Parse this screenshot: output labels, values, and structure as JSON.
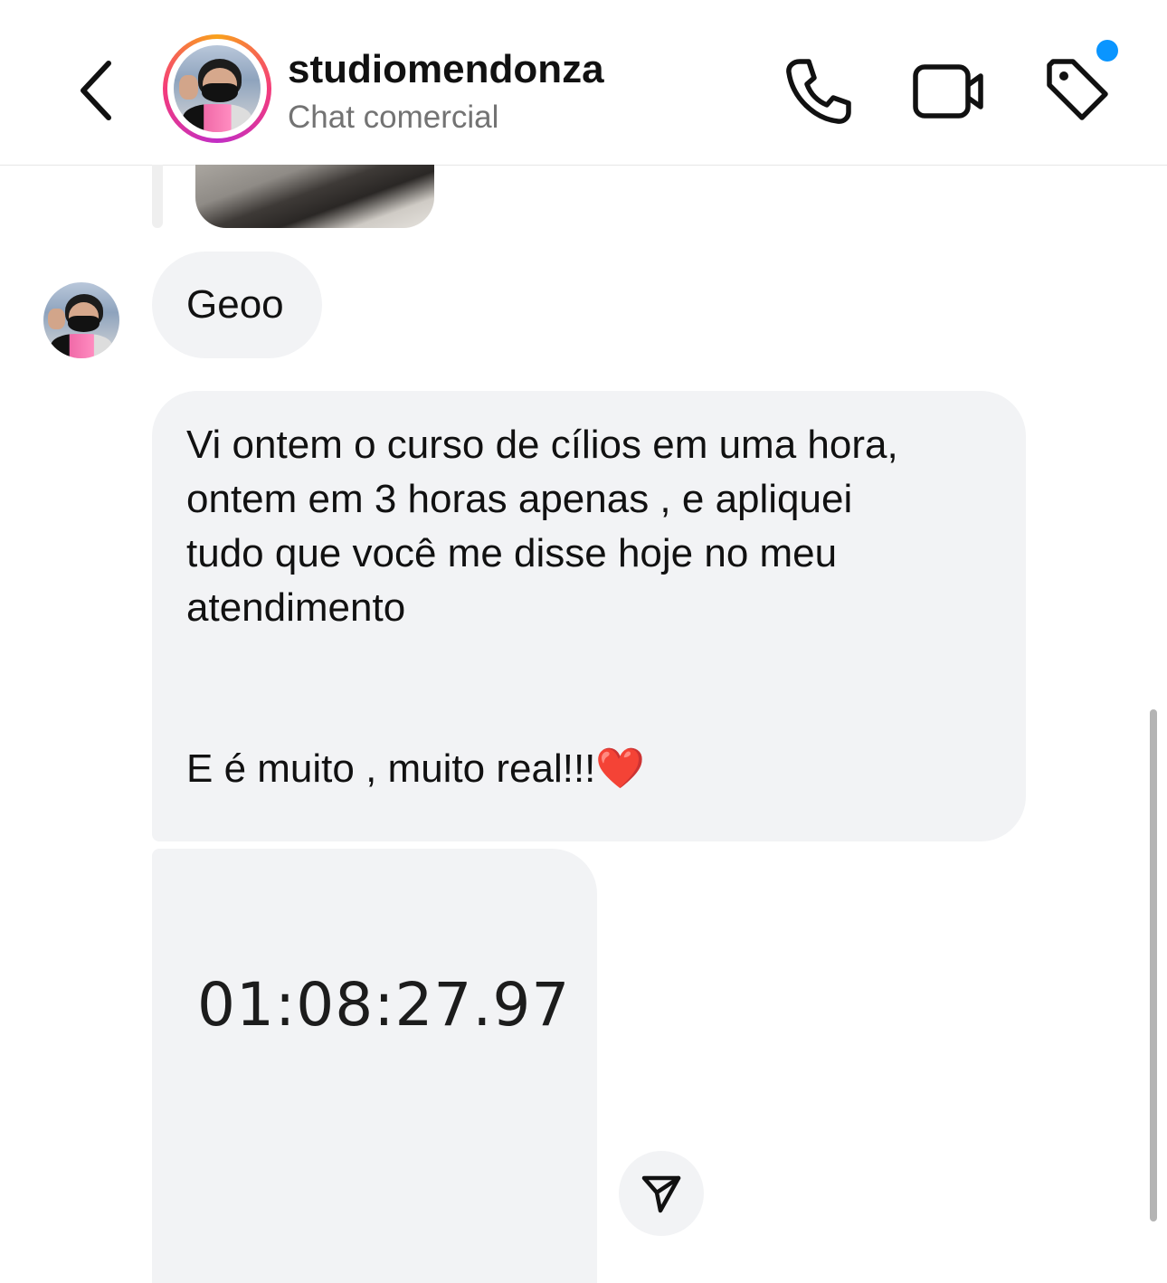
{
  "header": {
    "username": "studiomendonza",
    "subtitle": "Chat comercial",
    "has_notification": true,
    "accent_color": "#0a95ff"
  },
  "icons": [
    "chevron-left-icon",
    "phone-icon",
    "video-camera-icon",
    "tag-icon",
    "paper-plane-icon"
  ],
  "messages": [
    {
      "type": "media",
      "content": "photo"
    },
    {
      "type": "text",
      "text": "Geoo"
    },
    {
      "type": "text",
      "lines": [
        "Vi ontem o curso de cílios em uma hora,",
        "ontem em 3 horas apenas , e apliquei",
        "tudo que você me disse hoje no meu",
        "atendimento"
      ],
      "closing": "E é muito , muito real!!!",
      "emoji": "❤️"
    },
    {
      "type": "media",
      "caption": "01:08:27.97"
    }
  ]
}
